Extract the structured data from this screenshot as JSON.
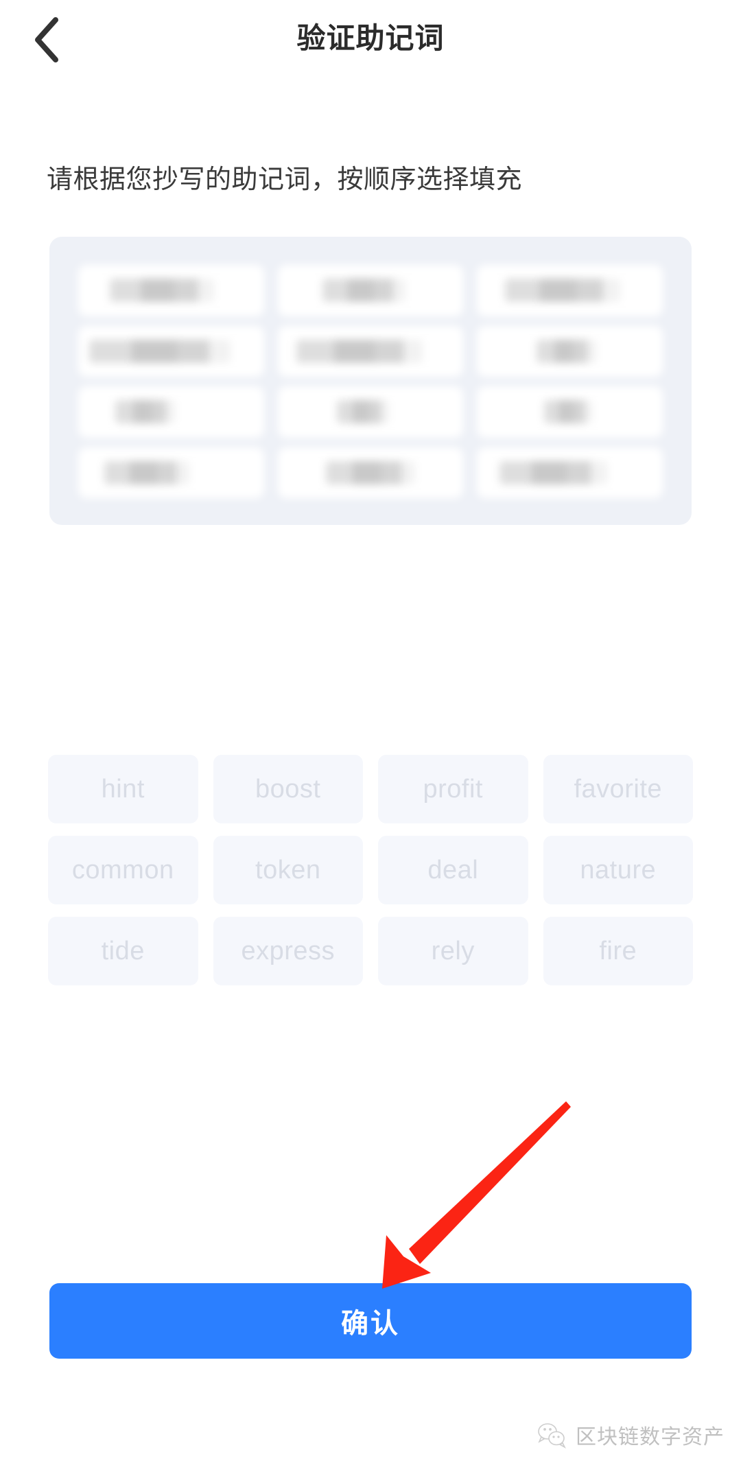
{
  "header": {
    "title": "验证助记词",
    "back_icon": "chevron-left-icon"
  },
  "instruction": "请根据您抄写的助记词，按顺序选择填充",
  "slots": {
    "count": 12,
    "state": "blurred",
    "items": [
      {
        "index": 1,
        "value": ""
      },
      {
        "index": 2,
        "value": ""
      },
      {
        "index": 3,
        "value": ""
      },
      {
        "index": 4,
        "value": ""
      },
      {
        "index": 5,
        "value": ""
      },
      {
        "index": 6,
        "value": ""
      },
      {
        "index": 7,
        "value": ""
      },
      {
        "index": 8,
        "value": ""
      },
      {
        "index": 9,
        "value": ""
      },
      {
        "index": 10,
        "value": ""
      },
      {
        "index": 11,
        "value": ""
      },
      {
        "index": 12,
        "value": ""
      }
    ]
  },
  "word_bank": {
    "words": [
      "hint",
      "boost",
      "profit",
      "favorite",
      "common",
      "token",
      "deal",
      "nature",
      "tide",
      "express",
      "rely",
      "fire"
    ]
  },
  "confirm": {
    "label": "确认"
  },
  "annotation": {
    "type": "arrow",
    "color": "#fb2414",
    "points_to": "confirm-button"
  },
  "watermark": {
    "text": "区块链数字资产",
    "icon": "wechat-icon"
  },
  "colors": {
    "accent": "#2b7fff",
    "panel_bg": "#eef1f7",
    "chip_bg": "#f5f7fc",
    "chip_text": "#d8dce5",
    "title": "#2b2b2b",
    "annotation": "#fb2414"
  }
}
